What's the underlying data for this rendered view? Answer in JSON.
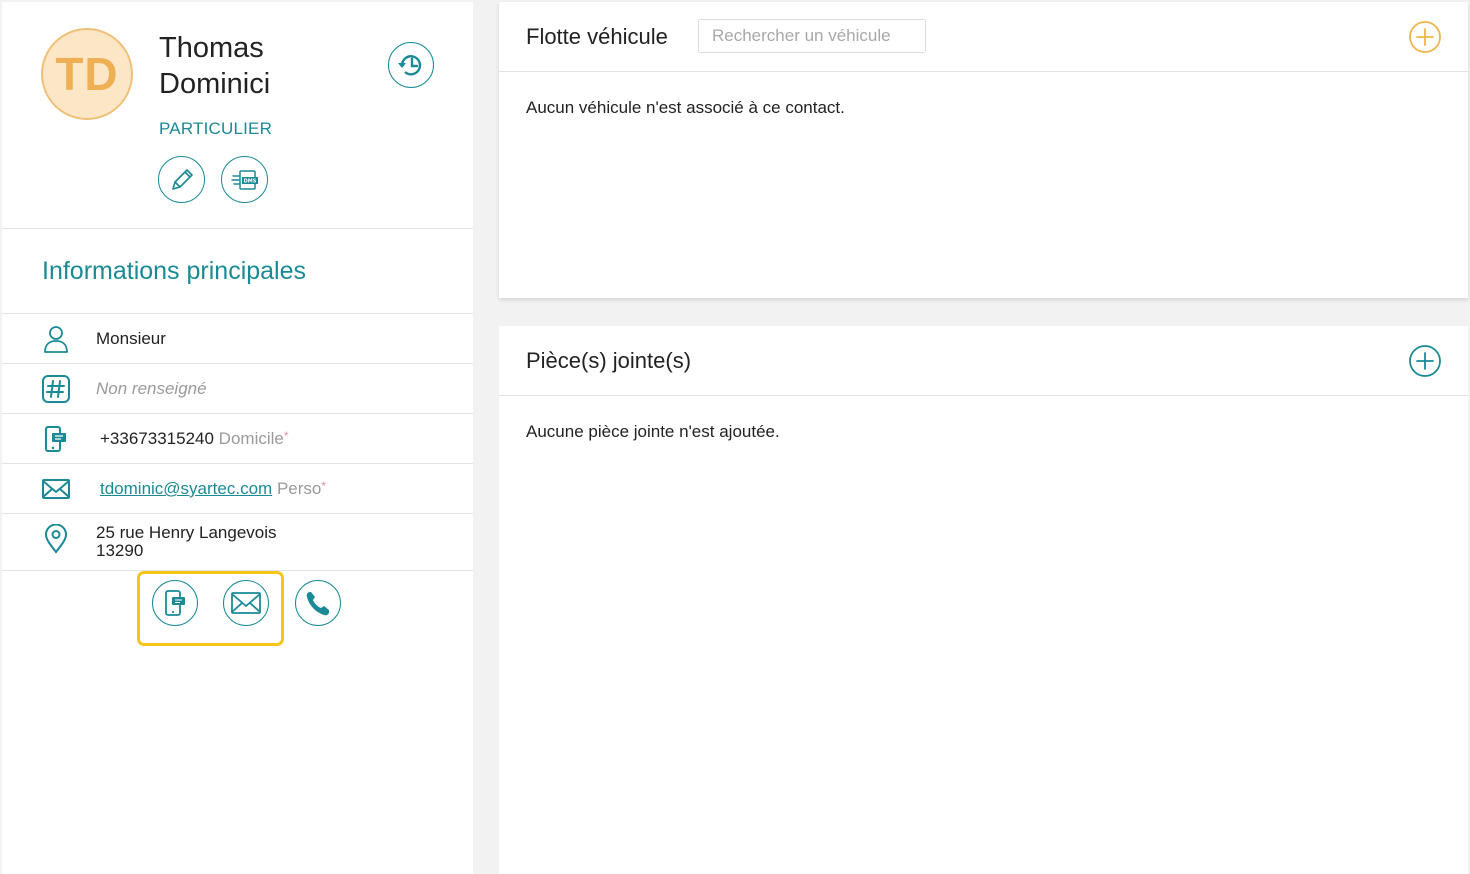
{
  "contact": {
    "initials": "TD",
    "first_name": "Thomas",
    "last_name": "Dominici",
    "type": "PARTICULIER"
  },
  "main_info": {
    "title": "Informations principales",
    "civility": "Monsieur",
    "identifier": "Non renseigné",
    "phone": {
      "value": "+33673315240",
      "label": "Domicile",
      "required_mark": "*"
    },
    "email": {
      "value": "tdominic@syartec.com",
      "label": "Perso",
      "required_mark": "*"
    },
    "address": {
      "street": "25 rue Henry Langevois",
      "postal_code": "13290"
    }
  },
  "fleet": {
    "title": "Flotte véhicule",
    "search_placeholder": "Rechercher un véhicule",
    "empty_message": "Aucun véhicule n'est associé à ce contact."
  },
  "attachments": {
    "title": "Pièce(s) jointe(s)",
    "empty_message": "Aucune pièce jointe n'est ajoutée."
  },
  "icons": {
    "history": "history-icon",
    "edit": "pencil-icon",
    "dms": "dms-icon",
    "civility": "person-icon",
    "identifier": "hash-icon",
    "phone": "mobile-phone-icon",
    "email": "envelope-icon",
    "address": "location-pin-icon",
    "sms_action": "sms-icon",
    "mail_action": "mail-icon",
    "call_action": "phone-icon",
    "add": "plus-circle-icon"
  },
  "colors": {
    "accent": "#1a8a96",
    "avatar_text": "#efb055",
    "avatar_bg": "#fbe7c6",
    "add_fleet": "#f0b54a",
    "highlight": "#f5c518"
  }
}
